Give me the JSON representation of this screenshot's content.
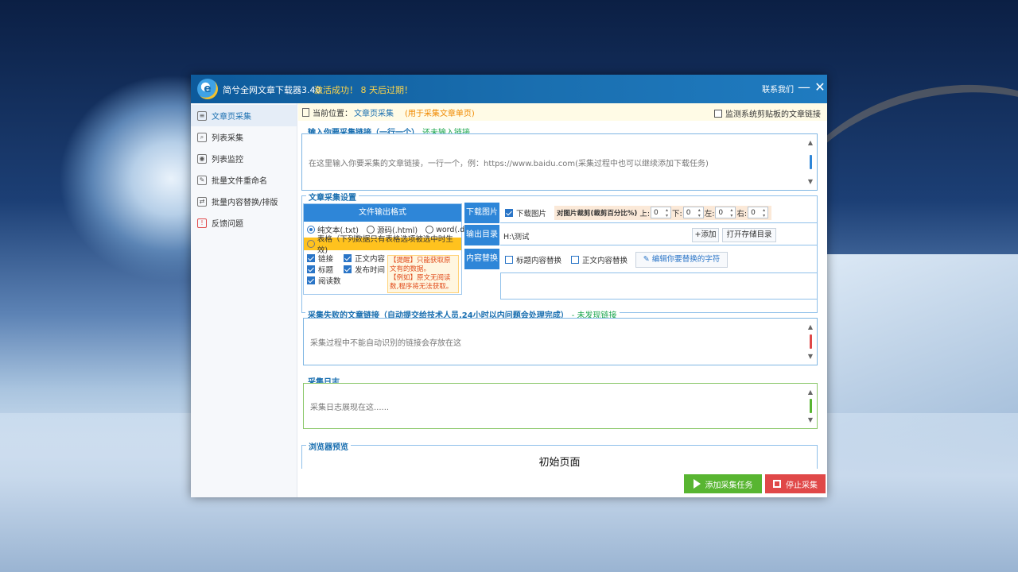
{
  "window": {
    "title": "简兮全网文章下载器3.40",
    "activation": "激活成功！ 8 天后过期！",
    "contact": "联系我们",
    "minimize": "—",
    "close": "✕"
  },
  "sidebar": {
    "items": [
      {
        "label": "文章页采集",
        "icon": "document-icon"
      },
      {
        "label": "列表采集",
        "icon": "list-search-icon"
      },
      {
        "label": "列表监控",
        "icon": "monitor-icon"
      },
      {
        "label": "批量文件重命名",
        "icon": "rename-icon"
      },
      {
        "label": "批量内容替换/排版",
        "icon": "replace-icon"
      },
      {
        "label": "反馈问题",
        "icon": "feedback-icon"
      }
    ]
  },
  "location": {
    "prefix": "当前位置：",
    "current": "文章页采集",
    "hint": "(用于采集文章单页)",
    "monitor_label": "监测系统剪贴板的文章链接"
  },
  "input_section": {
    "title": "输入你要采集链接（一行一个）",
    "status": "还未输入链接",
    "placeholder": "在这里输入你要采集的文章链接，一行一个，例：https://www.baidu.com(采集过程中也可以继续添加下载任务)"
  },
  "settings": {
    "title": "文章采集设置",
    "format_head": "文件输出格式",
    "formats": [
      "纯文本(.txt)",
      "源码(.html)",
      "word(.docx)"
    ],
    "selected_format": "纯文本(.txt)",
    "table_option": "表格（下列数据只有表格选项被选中时生效)",
    "fields": [
      "链接",
      "正文内容",
      "标题",
      "发布时间",
      "阅读数"
    ],
    "tip_lines": [
      "【提醒】只能获取原文有的数据。",
      "【例如】原文无阅读数,程序将无法获取。"
    ],
    "download_images": {
      "label": "下载图片",
      "checkbox_label": "下载图片",
      "crop_label": "对图片裁剪(裁剪百分比%)",
      "top_label": "上:",
      "top": "0",
      "bottom_label": "下:",
      "bottom": "0",
      "left_label": "左:",
      "left": "0",
      "right_label": "右:",
      "right": "0"
    },
    "output_dir": {
      "label": "输出目录",
      "value": "H:\\测试",
      "add_button": "+添加",
      "open_button": "打开存储目录"
    },
    "content_replace": {
      "label": "内容替换",
      "title_replace": "标题内容替换",
      "body_replace": "正文内容替换",
      "edit_button": "编辑你要替换的字符"
    }
  },
  "failed_section": {
    "title": "采集失败的文章链接（自动提交给技术人员,24小时以内问题会处理完成）",
    "status": "- 未发现链接",
    "placeholder": "采集过程中不能自动识别的链接会存放在这"
  },
  "log_section": {
    "title": "采集日志",
    "placeholder": "采集日志展现在这......"
  },
  "preview_section": {
    "title": "浏览器预览",
    "content": "初始页面"
  },
  "actions": {
    "add_task": "添加采集任务",
    "stop": "停止采集"
  },
  "colors": {
    "titlebar": "#1a6fb0",
    "accent": "#2e86d8",
    "activation": "#ffd54a",
    "add_button": "#58b531",
    "stop_button": "#e04848"
  }
}
